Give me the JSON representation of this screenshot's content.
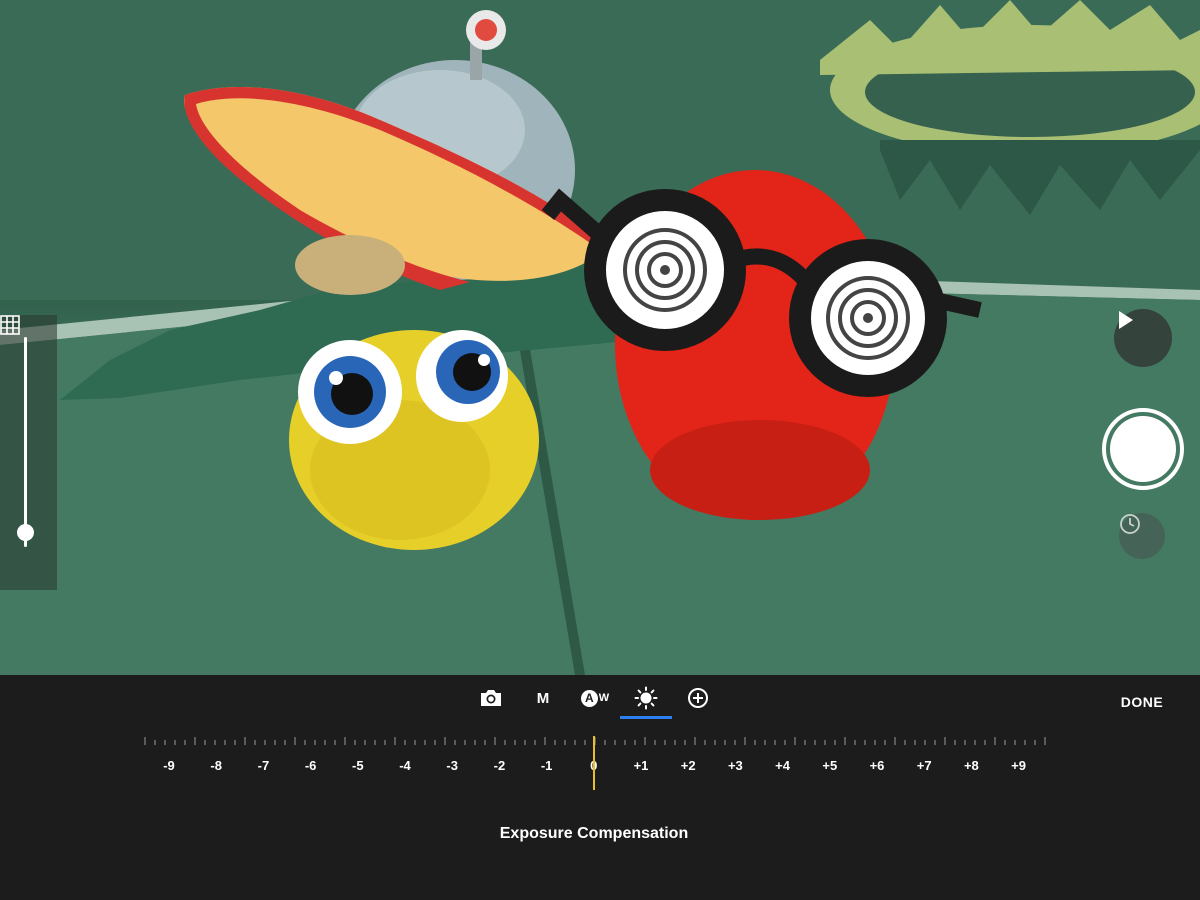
{
  "camera": {
    "mode_tabs": [
      {
        "name": "camera-icon"
      },
      {
        "label": "M"
      },
      {
        "name": "awb-icon",
        "label": "A",
        "sub": "W"
      },
      {
        "name": "exposure-icon",
        "active": true
      },
      {
        "name": "add-circle-icon"
      }
    ],
    "done_label": "DONE",
    "exposure": {
      "labels": [
        "-9",
        "-8",
        "-7",
        "-6",
        "-5",
        "-4",
        "-3",
        "-2",
        "-1",
        "0",
        "+1",
        "+2",
        "+3",
        "+4",
        "+5",
        "+6",
        "+7",
        "+8",
        "+9"
      ],
      "current_value": "0",
      "caption": "Exposure Compensation"
    },
    "accent_color": "#2d7ff0",
    "indicator_color": "#e6c02a"
  }
}
